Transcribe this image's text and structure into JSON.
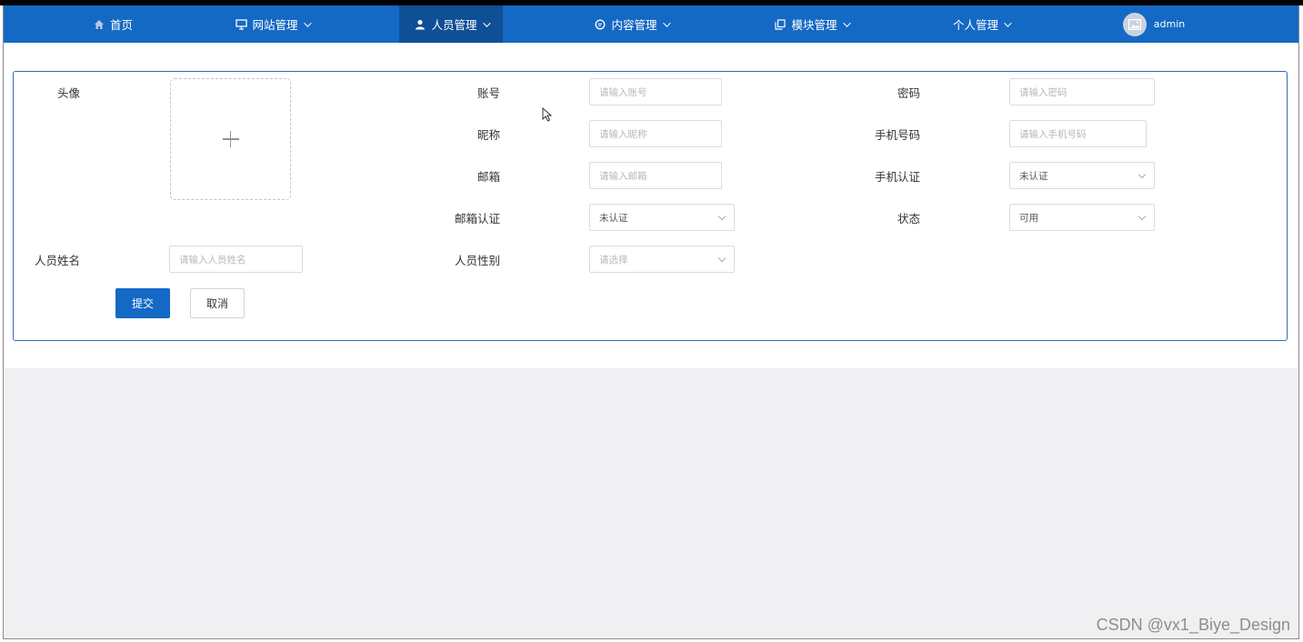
{
  "nav": {
    "items": [
      {
        "label": "首页",
        "icon": "home-icon"
      },
      {
        "label": "网站管理",
        "icon": "monitor-icon"
      },
      {
        "label": "人员管理",
        "icon": "user-icon",
        "active": true
      },
      {
        "label": "内容管理",
        "icon": "chat-icon"
      },
      {
        "label": "模块管理",
        "icon": "copy-icon"
      },
      {
        "label": "个人管理"
      }
    ],
    "user": {
      "name": "admin",
      "avatar_icon": "avatar-image-icon"
    },
    "colors": {
      "bar": "#1469c4",
      "active": "#0e4f96"
    }
  },
  "form": {
    "avatar_label": "头像",
    "account": {
      "label": "账号",
      "placeholder": "请输入账号"
    },
    "password": {
      "label": "密码",
      "placeholder": "请输入密码"
    },
    "nickname": {
      "label": "昵称",
      "placeholder": "请输入昵称"
    },
    "phone": {
      "label": "手机号码",
      "placeholder": "请输入手机号码"
    },
    "email": {
      "label": "邮箱",
      "placeholder": "请输入邮箱"
    },
    "phone_verify": {
      "label": "手机认证",
      "value": "未认证"
    },
    "email_verify": {
      "label": "邮箱认证",
      "value": "未认证"
    },
    "status": {
      "label": "状态",
      "value": "可用"
    },
    "name": {
      "label": "人员姓名",
      "placeholder": "请输入人员姓名"
    },
    "gender": {
      "label": "人员性别",
      "placeholder": "请选择"
    },
    "submit_label": "提交",
    "cancel_label": "取消"
  },
  "watermark": "CSDN @vx1_Biye_Design"
}
